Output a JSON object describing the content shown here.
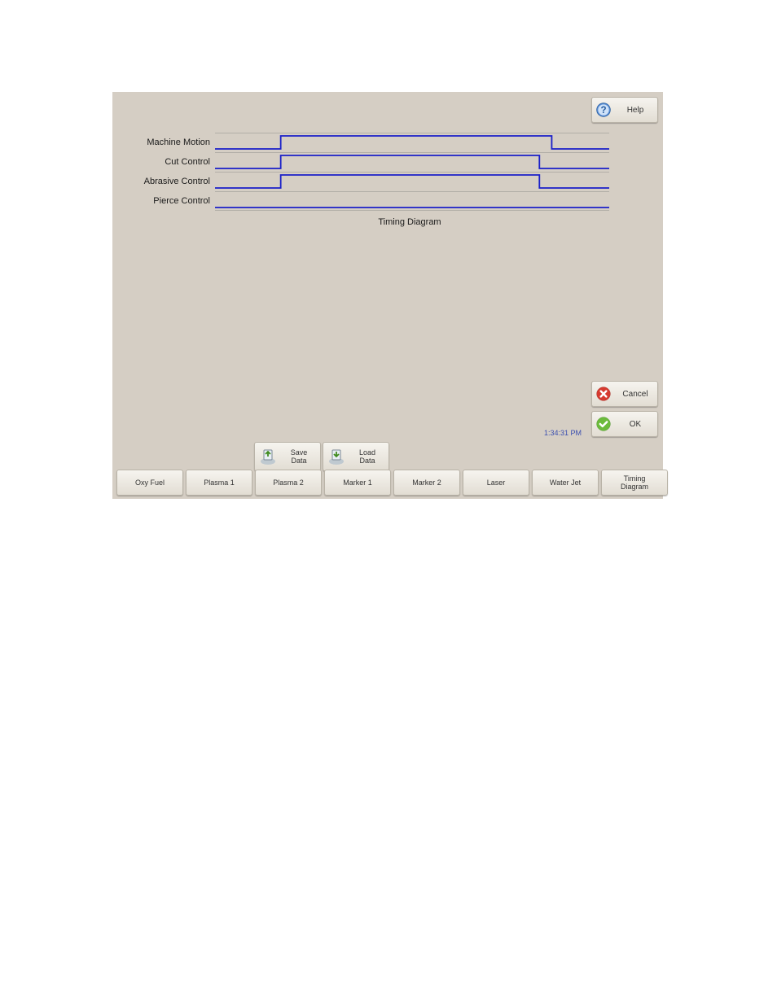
{
  "header": {
    "help_label": "Help"
  },
  "actions": {
    "cancel_label": "Cancel",
    "ok_label": "OK"
  },
  "clock": "1:34:31 PM",
  "data_buttons": {
    "save_label": "Save\nData",
    "load_label": "Load\nData"
  },
  "tabs": [
    {
      "label": "Oxy Fuel"
    },
    {
      "label": "Plasma 1"
    },
    {
      "label": "Plasma 2"
    },
    {
      "label": "Marker 1"
    },
    {
      "label": "Marker 2"
    },
    {
      "label": "Laser"
    },
    {
      "label": "Water Jet"
    },
    {
      "label": "Timing\nDiagram"
    }
  ],
  "diagram": {
    "title": "Timing Diagram",
    "signals": [
      {
        "label": "Machine Motion"
      },
      {
        "label": "Cut Control"
      },
      {
        "label": "Abrasive Control"
      },
      {
        "label": "Pierce Control"
      }
    ]
  },
  "chart_data": {
    "type": "timing-diagram",
    "title": "Timing Diagram",
    "x_range": [
      0,
      100
    ],
    "series": [
      {
        "name": "Machine Motion",
        "transitions": [
          0,
          17,
          85,
          100
        ],
        "levels": [
          0,
          1,
          0
        ]
      },
      {
        "name": "Cut Control",
        "transitions": [
          0,
          17,
          82,
          100
        ],
        "levels": [
          0,
          1,
          0
        ]
      },
      {
        "name": "Abrasive Control",
        "transitions": [
          0,
          17,
          82,
          100
        ],
        "levels": [
          0,
          1,
          0
        ]
      },
      {
        "name": "Pierce Control",
        "transitions": [
          0,
          100
        ],
        "levels": [
          0
        ]
      }
    ]
  }
}
